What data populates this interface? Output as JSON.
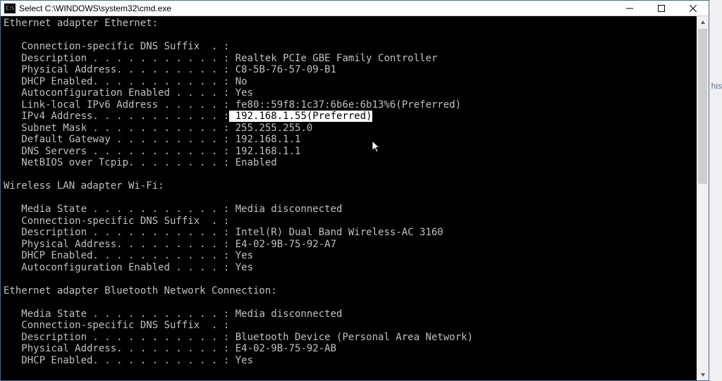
{
  "title": "Select C:\\WINDOWS\\system32\\cmd.exe",
  "side_hint": "his",
  "adapters": [
    {
      "header": "Ethernet adapter Ethernet:",
      "lines": [
        {
          "label": "   Connection-specific DNS Suffix  . :",
          "value": ""
        },
        {
          "label": "   Description . . . . . . . . . . . :",
          "value": " Realtek PCIe GBE Family Controller"
        },
        {
          "label": "   Physical Address. . . . . . . . . :",
          "value": " C8-5B-76-57-09-B1"
        },
        {
          "label": "   DHCP Enabled. . . . . . . . . . . :",
          "value": " No"
        },
        {
          "label": "   Autoconfiguration Enabled . . . . :",
          "value": " Yes"
        },
        {
          "label": "   Link-local IPv6 Address . . . . . :",
          "value": " fe80::59f8:1c37:6b6e:6b13%6(Preferred)"
        },
        {
          "label": "   IPv4 Address. . . . . . . . . . . :",
          "value": " 192.168.1.55(Preferred)",
          "highlight": true
        },
        {
          "label": "   Subnet Mask . . . . . . . . . . . :",
          "value": " 255.255.255.0"
        },
        {
          "label": "   Default Gateway . . . . . . . . . :",
          "value": " 192.168.1.1"
        },
        {
          "label": "   DNS Servers . . . . . . . . . . . :",
          "value": " 192.168.1.1"
        },
        {
          "label": "   NetBIOS over Tcpip. . . . . . . . :",
          "value": " Enabled"
        }
      ]
    },
    {
      "header": "Wireless LAN adapter Wi-Fi:",
      "lines": [
        {
          "label": "   Media State . . . . . . . . . . . :",
          "value": " Media disconnected"
        },
        {
          "label": "   Connection-specific DNS Suffix  . :",
          "value": ""
        },
        {
          "label": "   Description . . . . . . . . . . . :",
          "value": " Intel(R) Dual Band Wireless-AC 3160"
        },
        {
          "label": "   Physical Address. . . . . . . . . :",
          "value": " E4-02-9B-75-92-A7"
        },
        {
          "label": "   DHCP Enabled. . . . . . . . . . . :",
          "value": " Yes"
        },
        {
          "label": "   Autoconfiguration Enabled . . . . :",
          "value": " Yes"
        }
      ]
    },
    {
      "header": "Ethernet adapter Bluetooth Network Connection:",
      "lines": [
        {
          "label": "   Media State . . . . . . . . . . . :",
          "value": " Media disconnected"
        },
        {
          "label": "   Connection-specific DNS Suffix  . :",
          "value": ""
        },
        {
          "label": "   Description . . . . . . . . . . . :",
          "value": " Bluetooth Device (Personal Area Network)"
        },
        {
          "label": "   Physical Address. . . . . . . . . :",
          "value": " E4-02-9B-75-92-AB"
        },
        {
          "label": "   DHCP Enabled. . . . . . . . . . . :",
          "value": " Yes"
        }
      ]
    }
  ]
}
